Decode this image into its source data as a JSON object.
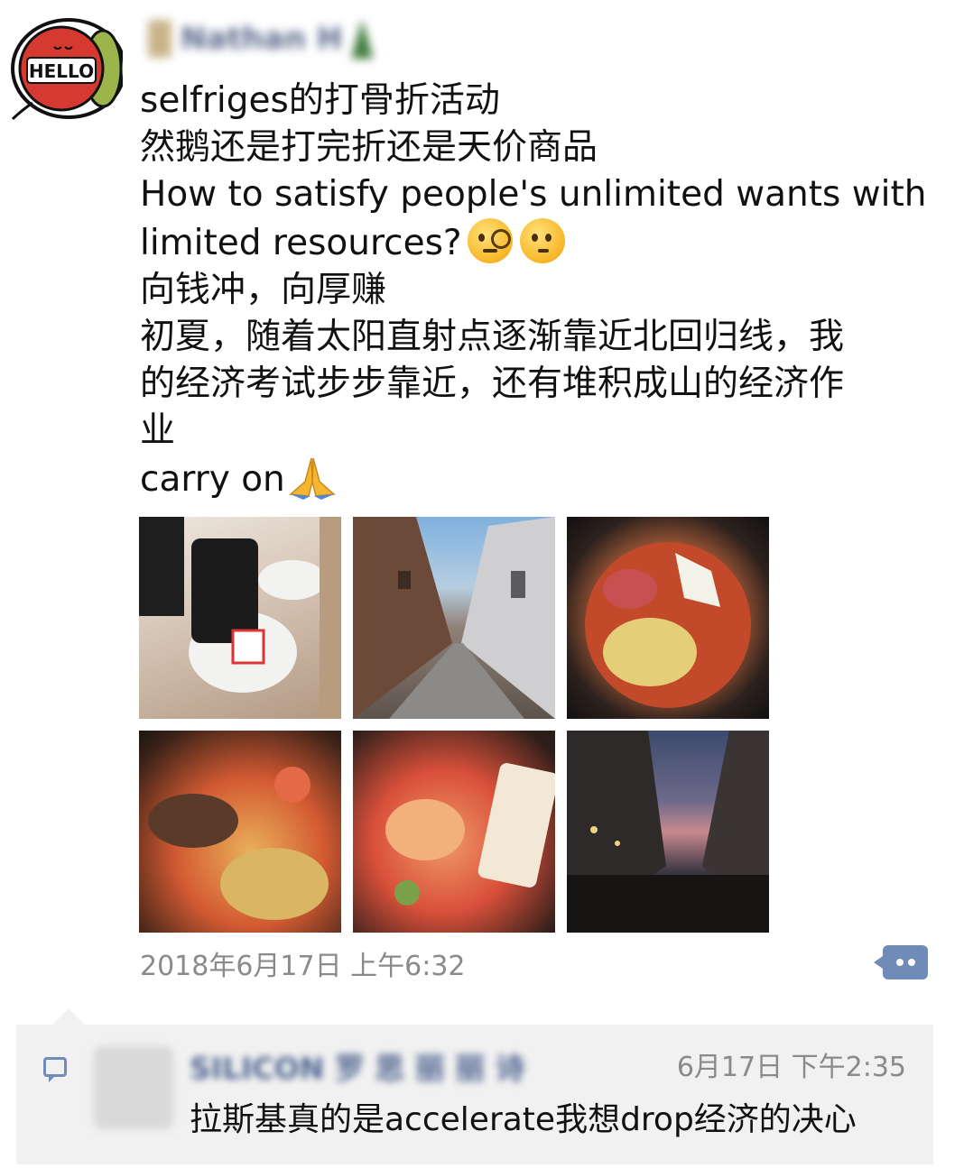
{
  "post": {
    "author": "Nathan H",
    "lines": [
      "selfriges的打骨折活动",
      "然鹅还是打完折还是天价商品",
      "How to satisfy people's unlimited wants with",
      "limited resources?",
      "向钱冲，向厚赚",
      "初夏，随着太阳直射点逐渐靠近北回归线，我",
      "的经济考试步步靠近，还有堆积成山的经济作",
      "业",
      "carry on"
    ],
    "emoji": [
      "monocle-face-icon",
      "thinking-face-icon",
      "folded-hands-icon"
    ],
    "photos": [
      {
        "name": "luggage-sale-photo"
      },
      {
        "name": "street-photo"
      },
      {
        "name": "hotpot-photo-1"
      },
      {
        "name": "hotpot-photo-2"
      },
      {
        "name": "hotpot-photo-3"
      },
      {
        "name": "evening-street-photo"
      }
    ],
    "timestamp": "2018年6月17日 上午6:32"
  },
  "avatar": {
    "text": "HELLO"
  },
  "comment": {
    "author": "SILICON 罗 思 丽 丽 诗",
    "time": "6月17日 下午2:35",
    "text": "拉斯基真的是accelerate我想drop经济的决心"
  },
  "colors": {
    "link": "#6f8bb8",
    "comment_bg": "#f1f1f1",
    "meta": "#8a8a8a"
  }
}
